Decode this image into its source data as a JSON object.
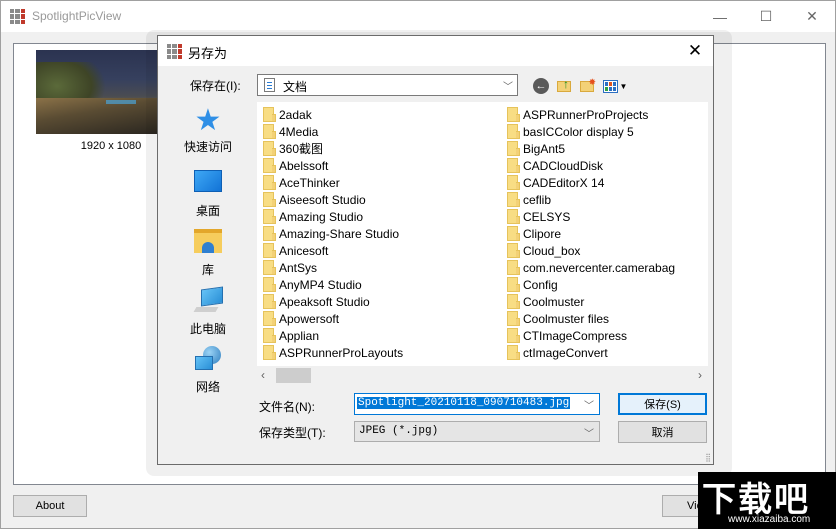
{
  "main_window": {
    "title": "SpotlightPicView",
    "controls": {
      "minimize": "—",
      "maximize": "☐",
      "close": "✕"
    },
    "thumbnail": {
      "caption": "1920 x 1080"
    },
    "about_button": "About",
    "view_button": "View"
  },
  "dialog": {
    "title": "另存为",
    "close": "✕",
    "save_in_label": "保存在(I):",
    "save_in_value": "文档",
    "toolbar": {
      "back": "back-icon",
      "up": "up-folder-icon",
      "new_folder": "new-folder-icon",
      "views": "view-menu-icon"
    },
    "places": [
      {
        "label": "快速访问",
        "icon": "quick-access-icon"
      },
      {
        "label": "桌面",
        "icon": "desktop-icon"
      },
      {
        "label": "库",
        "icon": "library-icon"
      },
      {
        "label": "此电脑",
        "icon": "this-pc-icon"
      },
      {
        "label": "网络",
        "icon": "network-icon"
      }
    ],
    "files_col1": [
      "2adak",
      "4Media",
      "360截图",
      "Abelssoft",
      "AceThinker",
      "Aiseesoft Studio",
      "Amazing Studio",
      "Amazing-Share Studio",
      "Anicesoft",
      "AntSys",
      "AnyMP4 Studio",
      "Apeaksoft Studio",
      "Apowersoft",
      "Applian",
      "ASPRunnerProLayouts"
    ],
    "files_col2": [
      "ASPRunnerProProjects",
      "basICColor display 5",
      "BigAnt5",
      "CADCloudDisk",
      "CADEditorX 14",
      "ceflib",
      "CELSYS",
      "Clipore",
      "Cloud_box",
      "com.nevercenter.camerabag",
      "Config",
      "Coolmuster",
      "Coolmuster files",
      "CTImageCompress",
      "ctImageConvert"
    ],
    "filename_label": "文件名(N):",
    "filename_value": "Spotlight_20210118_090710483.jpg",
    "filetype_label": "保存类型(T):",
    "filetype_value": "JPEG (*.jpg)",
    "save_button": "保存(S)",
    "cancel_button": "取消"
  },
  "watermark": {
    "text": "下载吧",
    "url": "www.xiazaiba.com"
  }
}
